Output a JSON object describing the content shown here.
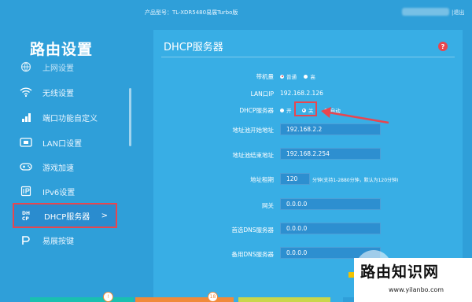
{
  "header": {
    "model_text": "产品型号：TL-XDR5480易展Turbo版",
    "logout": "|退出"
  },
  "sidebar": {
    "title": "路由设置",
    "items": [
      {
        "label": "上网设置",
        "icon": "globe-icon"
      },
      {
        "label": "无线设置",
        "icon": "wifi-icon"
      },
      {
        "label": "端口功能自定义",
        "icon": "port-icon"
      },
      {
        "label": "LAN口设置",
        "icon": "lan-icon"
      },
      {
        "label": "游戏加速",
        "icon": "gamepad-icon"
      },
      {
        "label": "IPv6设置",
        "icon": "ipv6-icon"
      },
      {
        "label": "DHCP服务器",
        "icon": "dhcp-icon",
        "active": true,
        "chevron": ">"
      },
      {
        "label": "易展按键",
        "icon": "easymesh-icon"
      }
    ]
  },
  "panel": {
    "title": "DHCP服务器",
    "help": "?",
    "rows": {
      "mode": {
        "label": "带机量",
        "options": [
          "普通",
          "高"
        ],
        "selected": "普通"
      },
      "lan_ip": {
        "label": "LAN口IP",
        "value": "192.168.2.126"
      },
      "dhcp": {
        "label": "DHCP服务器",
        "options": [
          "开",
          "关",
          "自动"
        ],
        "selected": "关"
      },
      "pool_start": {
        "label": "地址池开始地址",
        "value": "192.168.2.2"
      },
      "pool_end": {
        "label": "地址池结束地址",
        "value": "192.168.2.254"
      },
      "lease": {
        "label": "地址租期",
        "value": "120",
        "hint": "分钟(支持1-2880分钟，默认为120分钟)"
      },
      "gateway": {
        "label": "网关",
        "value": "0.0.0.0"
      },
      "dns1": {
        "label": "首选DNS服务器",
        "value": "0.0.0.0"
      },
      "dns2": {
        "label": "备用DNS服务器",
        "value": "0.0.0.0"
      }
    }
  },
  "bottom": {
    "badge1": "!",
    "badge2": "18",
    "colors": [
      "#19c0b0",
      "#f08a3a",
      "#c9d64a",
      "#2f9fd9"
    ]
  },
  "watermark": {
    "title": "路由知识网",
    "url": "www.yilanbo.com"
  },
  "colors": {
    "background": "#2f9fd9",
    "panel": "#38aee5",
    "input": "#2d8fd0",
    "accent_red": "#e8464f"
  }
}
